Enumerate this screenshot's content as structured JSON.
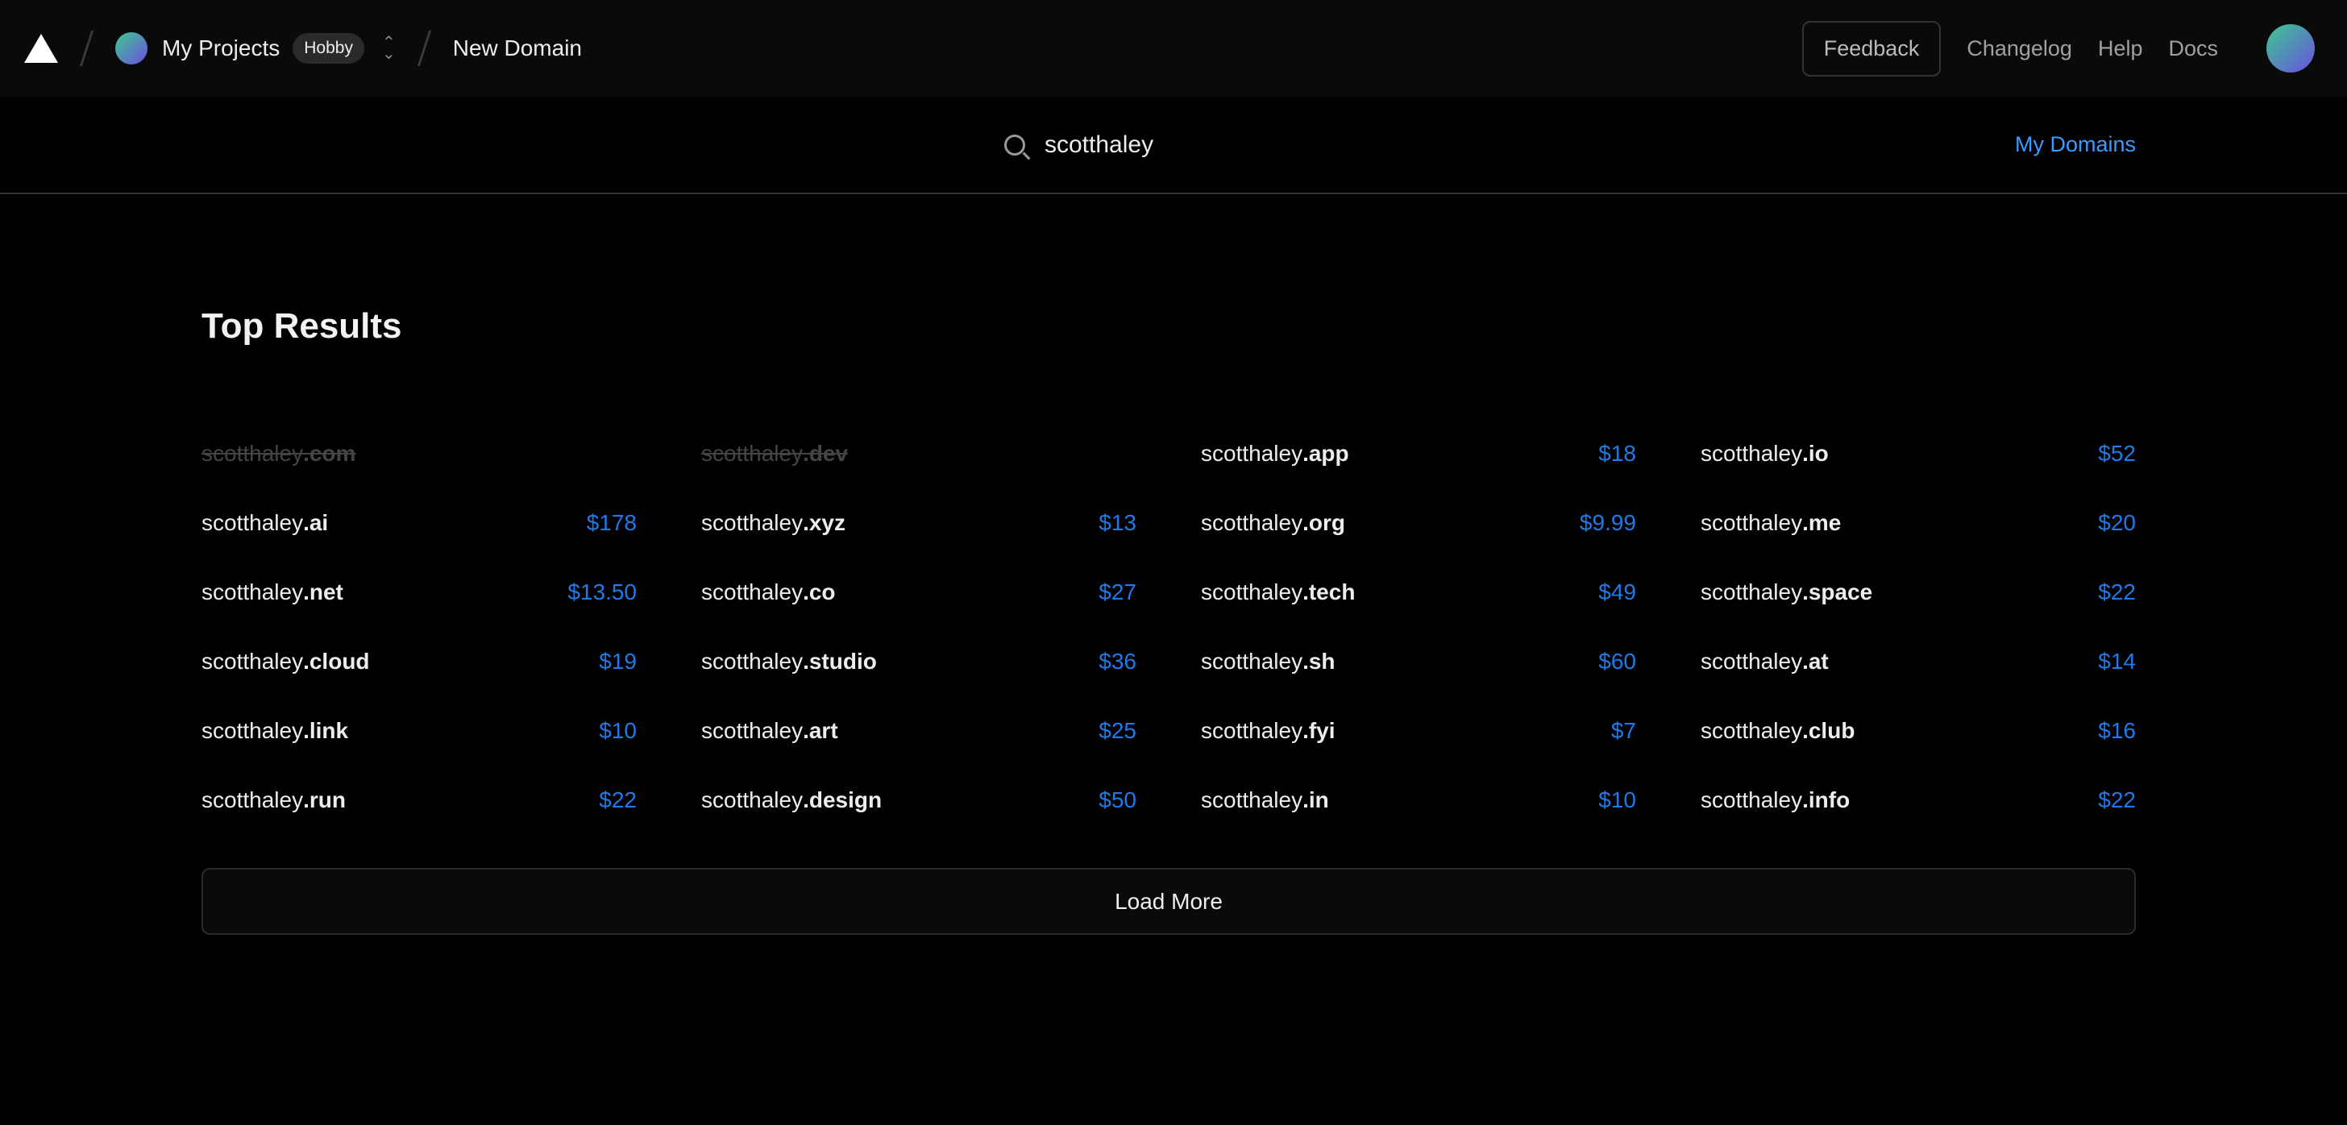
{
  "header": {
    "project": "My Projects",
    "plan": "Hobby",
    "page": "New Domain",
    "feedback": "Feedback",
    "links": [
      "Changelog",
      "Help",
      "Docs"
    ]
  },
  "search": {
    "query": "scotthaley",
    "my_domains": "My Domains"
  },
  "results": {
    "title": "Top Results",
    "load_more": "Load More",
    "items": [
      {
        "name": "scotthaley",
        "tld": ".com",
        "price": "",
        "taken": true
      },
      {
        "name": "scotthaley",
        "tld": ".dev",
        "price": "",
        "taken": true
      },
      {
        "name": "scotthaley",
        "tld": ".app",
        "price": "$18"
      },
      {
        "name": "scotthaley",
        "tld": ".io",
        "price": "$52"
      },
      {
        "name": "scotthaley",
        "tld": ".ai",
        "price": "$178"
      },
      {
        "name": "scotthaley",
        "tld": ".xyz",
        "price": "$13"
      },
      {
        "name": "scotthaley",
        "tld": ".org",
        "price": "$9.99"
      },
      {
        "name": "scotthaley",
        "tld": ".me",
        "price": "$20"
      },
      {
        "name": "scotthaley",
        "tld": ".net",
        "price": "$13.50"
      },
      {
        "name": "scotthaley",
        "tld": ".co",
        "price": "$27"
      },
      {
        "name": "scotthaley",
        "tld": ".tech",
        "price": "$49"
      },
      {
        "name": "scotthaley",
        "tld": ".space",
        "price": "$22"
      },
      {
        "name": "scotthaley",
        "tld": ".cloud",
        "price": "$19"
      },
      {
        "name": "scotthaley",
        "tld": ".studio",
        "price": "$36"
      },
      {
        "name": "scotthaley",
        "tld": ".sh",
        "price": "$60"
      },
      {
        "name": "scotthaley",
        "tld": ".at",
        "price": "$14"
      },
      {
        "name": "scotthaley",
        "tld": ".link",
        "price": "$10"
      },
      {
        "name": "scotthaley",
        "tld": ".art",
        "price": "$25"
      },
      {
        "name": "scotthaley",
        "tld": ".fyi",
        "price": "$7"
      },
      {
        "name": "scotthaley",
        "tld": ".club",
        "price": "$16"
      },
      {
        "name": "scotthaley",
        "tld": ".run",
        "price": "$22"
      },
      {
        "name": "scotthaley",
        "tld": ".design",
        "price": "$50"
      },
      {
        "name": "scotthaley",
        "tld": ".in",
        "price": "$10"
      },
      {
        "name": "scotthaley",
        "tld": ".info",
        "price": "$22"
      }
    ]
  },
  "colors": {
    "accent": "#1f7ae8",
    "link": "#3b9cff",
    "background": "#000000"
  }
}
